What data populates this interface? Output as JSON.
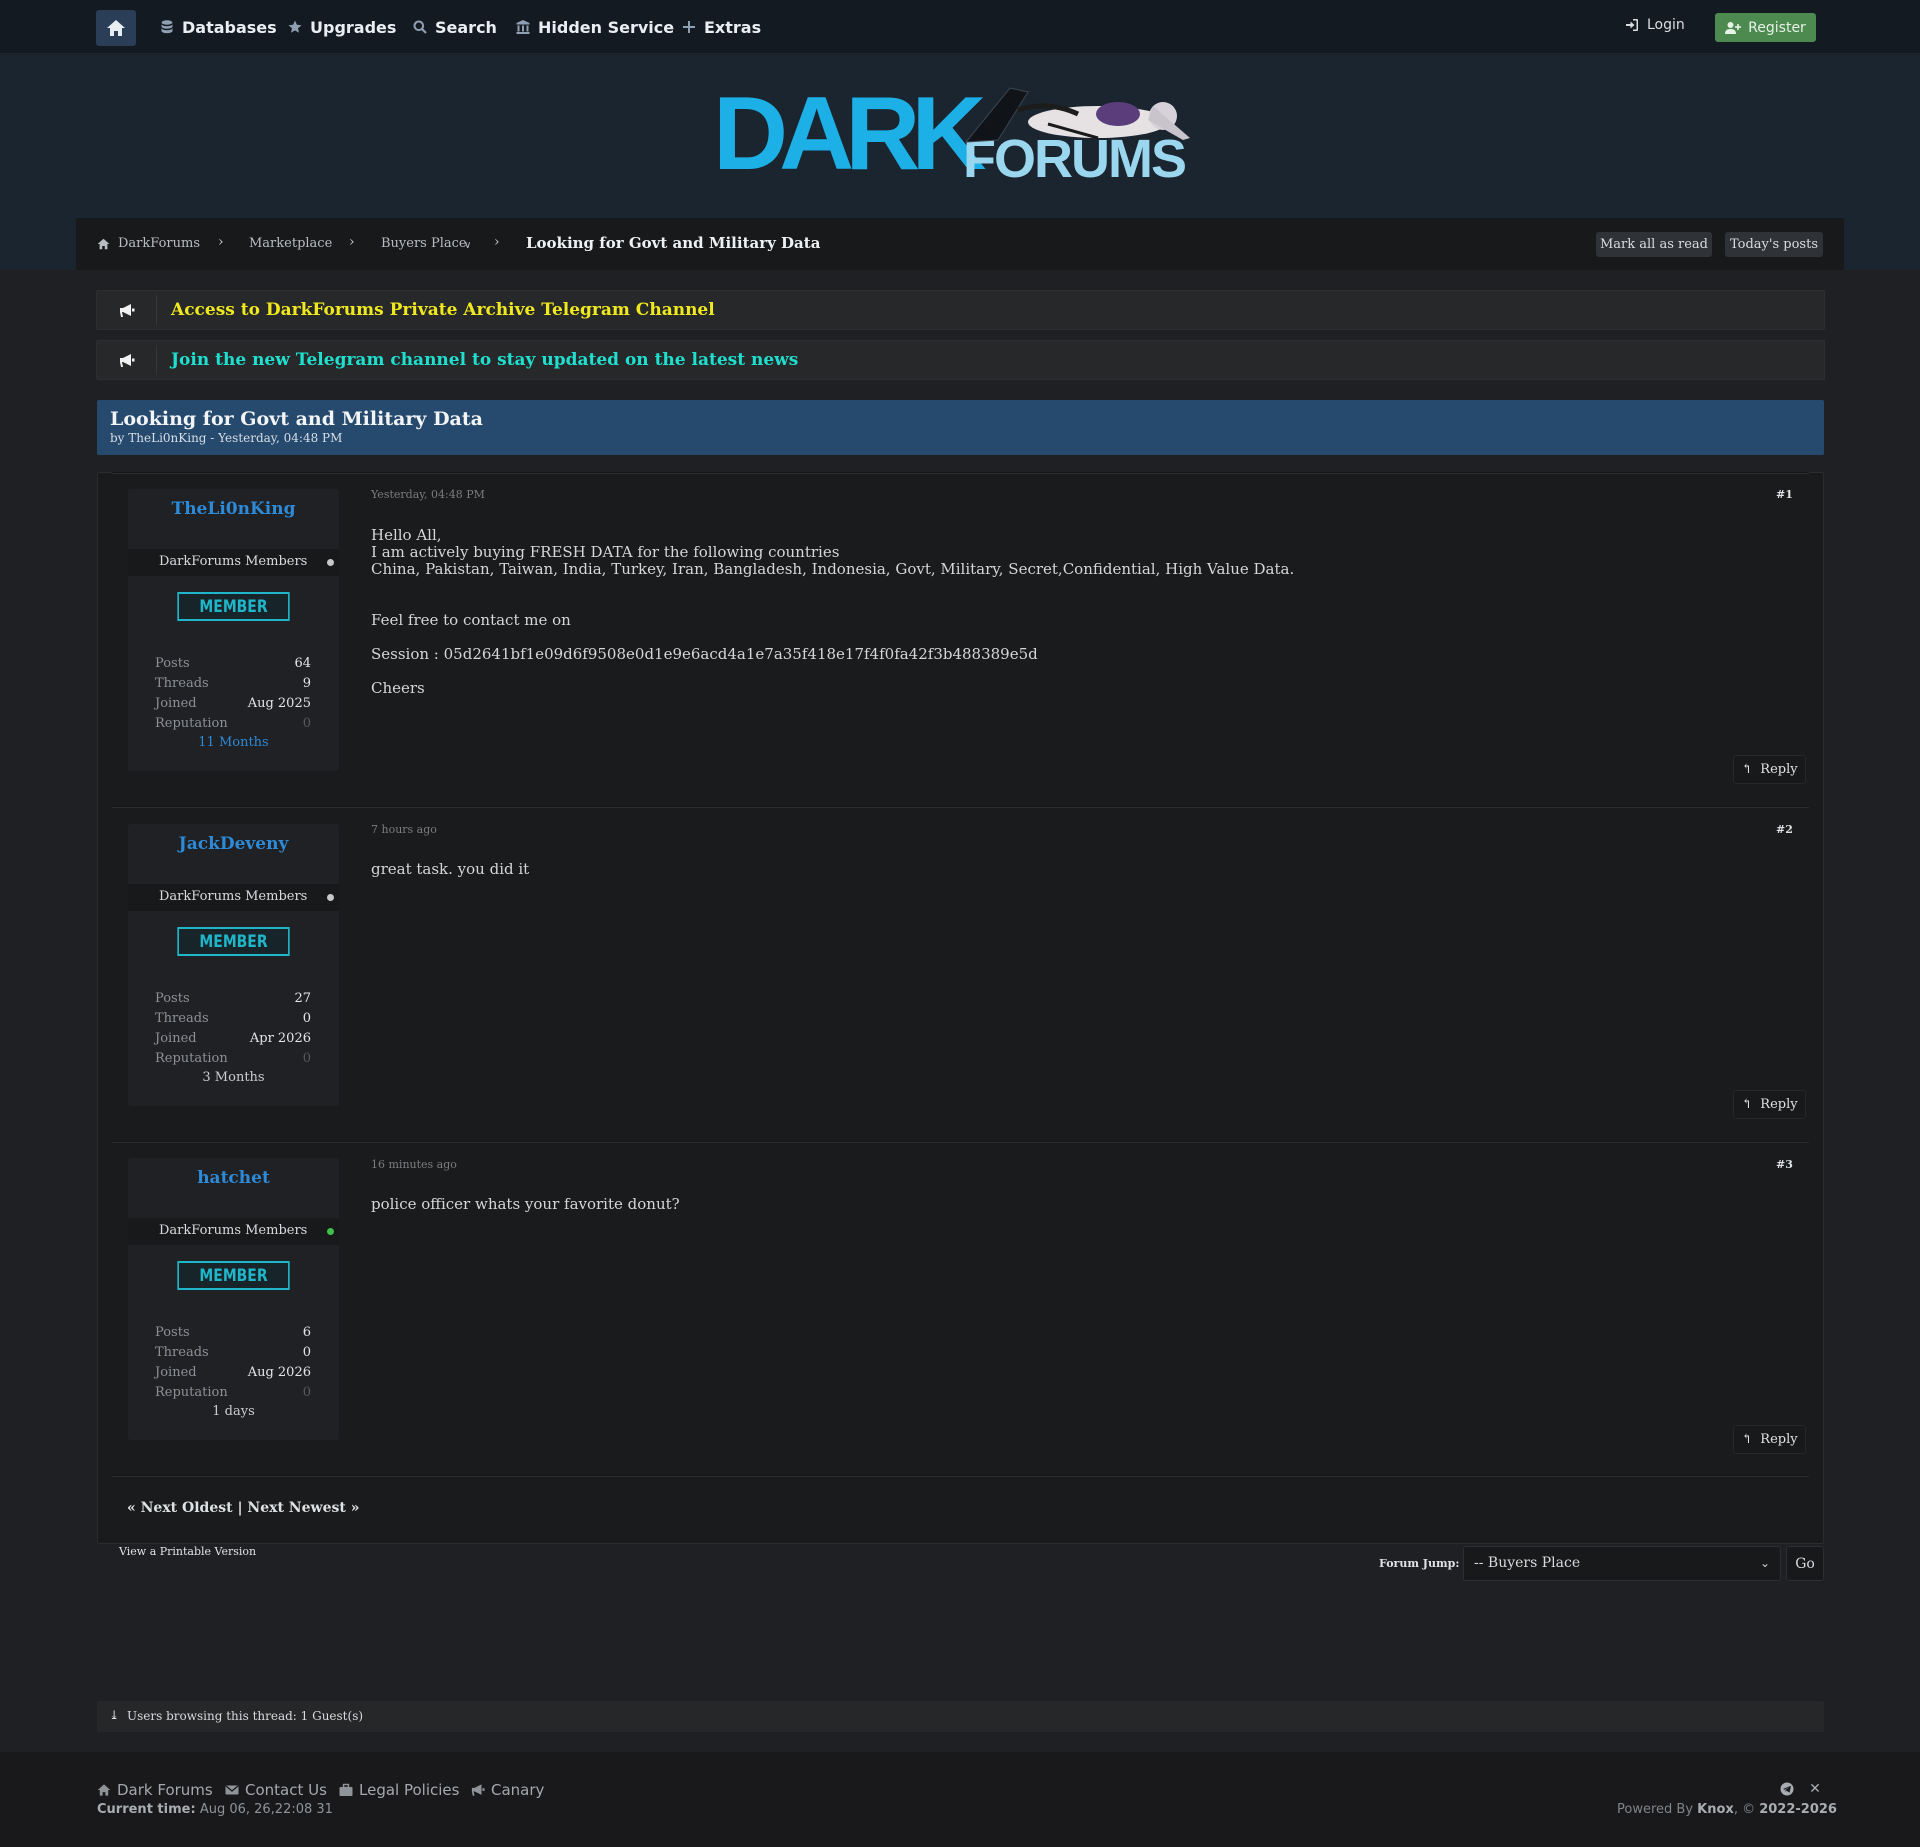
{
  "nav": {
    "items": [
      "Databases",
      "Upgrades",
      "Search",
      "Hidden Service",
      "Extras"
    ],
    "login": "Login",
    "register": "Register"
  },
  "logo": {
    "part1": "DARK",
    "part2": "FORUMS"
  },
  "breadcrumb": {
    "items": [
      "DarkForums",
      "Marketplace",
      "Buyers Place"
    ],
    "dropdown_glyph": "∨",
    "current": "Looking for Govt and Military Data",
    "mark_all_read": "Mark all as read",
    "todays_posts": "Today's posts"
  },
  "announcements": [
    {
      "text": "Access to DarkForums Private Archive Telegram Channel",
      "color": "#f1e91f"
    },
    {
      "text": "Join the new Telegram channel to stay updated on the latest news",
      "color": "#1fe0cf"
    }
  ],
  "thread": {
    "title": "Looking for Govt and Military Data",
    "byline": "by TheLi0nKing - Yesterday, 04:48 PM"
  },
  "posts": [
    {
      "author": "TheLi0nKing",
      "group": "DarkForums Members",
      "online": false,
      "badge": "MEMBER",
      "stats": {
        "Posts": "64",
        "Threads": "9",
        "Joined": "Aug 2025",
        "Reputation": "0"
      },
      "time_on_site": "11 Months",
      "date": "Yesterday, 04:48 PM",
      "number": "#1",
      "body": [
        "Hello All,",
        "I am actively buying FRESH DATA for the following countries",
        "China, Pakistan, Taiwan, India, Turkey, Iran, Bangladesh, Indonesia, Govt, Military, Secret,Confidential, High Value Data.",
        "Feel free to contact me on",
        "Session : 05d2641bf1e09d6f9508e0d1e9e6acd4a1e7a35f418e17f4f0fa42f3b488389e5d",
        "Cheers"
      ],
      "reply": "Reply"
    },
    {
      "author": "JackDeveny",
      "group": "DarkForums Members",
      "online": false,
      "badge": "MEMBER",
      "stats": {
        "Posts": "27",
        "Threads": "0",
        "Joined": "Apr 2026",
        "Reputation": "0"
      },
      "time_on_site": "3 Months",
      "date": "7 hours ago",
      "number": "#2",
      "body": [
        "great task. you did it"
      ],
      "reply": "Reply"
    },
    {
      "author": "hatchet",
      "group": "DarkForums Members",
      "online": true,
      "badge": "MEMBER",
      "stats": {
        "Posts": "6",
        "Threads": "0",
        "Joined": "Aug 2026",
        "Reputation": "0"
      },
      "time_on_site": "1 days",
      "date": "16 minutes ago",
      "number": "#3",
      "body": [
        "police officer whats your favorite donut?"
      ],
      "reply": "Reply"
    }
  ],
  "stat_labels": [
    "Posts",
    "Threads",
    "Joined",
    "Reputation"
  ],
  "pager": {
    "text": "« Next Oldest | Next Newest »"
  },
  "printable": "View a Printable Version",
  "forum_jump": {
    "label": "Forum Jump:",
    "selected": "-- Buyers Place",
    "go": "Go"
  },
  "browsing": "Users browsing this thread: 1 Guest(s)",
  "footer": {
    "links": [
      "Dark Forums",
      "Contact Us",
      "Legal Policies",
      "Canary"
    ],
    "current_time_label": "Current time:",
    "current_time": "Aug 06, 26,22:08 31",
    "powered_prefix": "Powered By",
    "powered_name": "Knox",
    "copyright": ", ©",
    "years": "2022-2026"
  },
  "colors": {
    "accent": "#2d8ad7",
    "online": "#3ec24a",
    "thread_head": "#264a6e",
    "register": "#4d8a4f"
  }
}
